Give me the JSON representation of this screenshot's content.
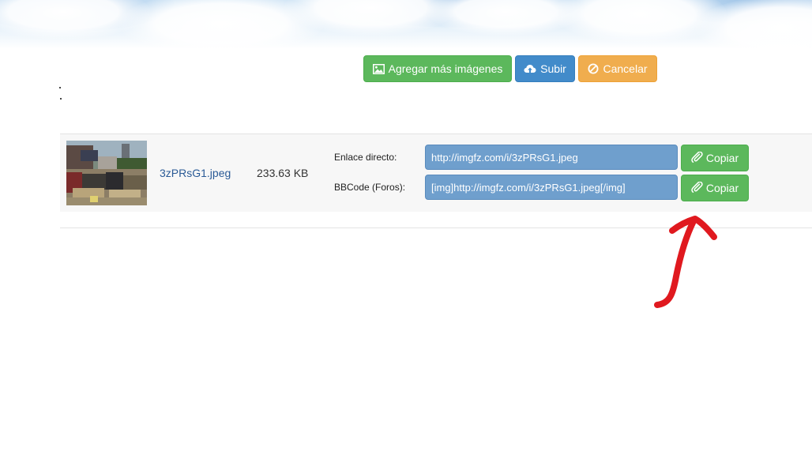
{
  "toolbar": {
    "add_images_label": "Agregar más imágenes",
    "upload_label": "Subir",
    "cancel_label": "Cancelar"
  },
  "upload": {
    "file": {
      "name": "3zPRsG1.jpeg",
      "size": "233.63 KB"
    },
    "links": [
      {
        "label": "Enlace directo:",
        "value": "http://imgfz.com/i/3zPRsG1.jpeg",
        "copy_label": "Copiar"
      },
      {
        "label": "BBCode (Foros):",
        "value": "[img]http://imgfz.com/i/3zPRsG1.jpeg[/img]",
        "copy_label": "Copiar"
      }
    ]
  },
  "colors": {
    "success": "#5cb85c",
    "primary": "#428bca",
    "warning": "#f0ad4e",
    "link_field": "#6f9fcd",
    "annotation": "#e0191f"
  },
  "icons": {
    "add_images": "image-icon",
    "upload": "cloud-upload-icon",
    "cancel": "ban-icon",
    "copy": "paperclip-icon"
  }
}
